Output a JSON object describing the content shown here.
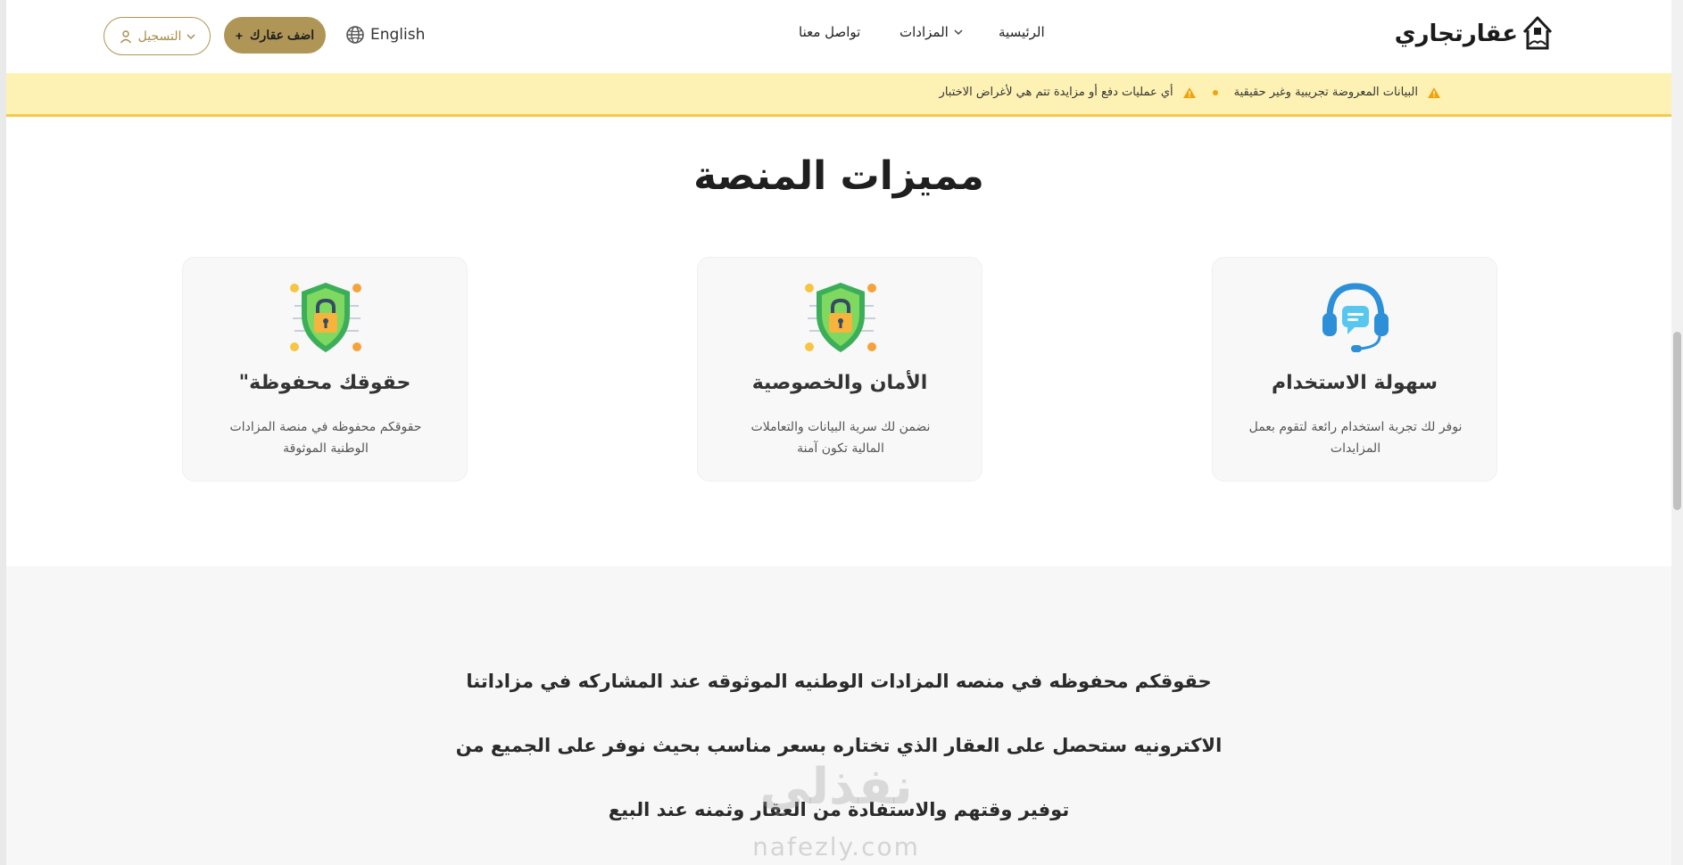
{
  "header": {
    "logo_text": "عقارتجاري",
    "nav": {
      "home": "الرئيسية",
      "auctions": "المزادات",
      "contact": "تواصل معنا"
    },
    "language": "English",
    "add_property": "اضف عقارك",
    "register": "التسجيل"
  },
  "banner": {
    "notice_1": "البيانات المعروضة تجريبية وغير حقيقية",
    "notice_2": "أي عمليات دفع أو مزايدة تتم هي لأغراض الاختبار"
  },
  "features": {
    "title": "مميزات المنصة",
    "cards": [
      {
        "title": "سهولة الاستخدام",
        "desc": "نوفر لك تجربة استخدام رائعة لتقوم بعمل المزايدات",
        "icon": "headset-chat-icon"
      },
      {
        "title": "الأمان والخصوصية",
        "desc": "نضمن لك سرية البيانات والتعاملات المالية تكون آمنة",
        "icon": "shield-lock-icon"
      },
      {
        "title": "\"حقوقك محفوظة",
        "desc": "حقوقكم محفوظه في منصة المزادات الوطنية الموثوقة",
        "icon": "shield-lock-icon"
      }
    ]
  },
  "about": {
    "lines": [
      "حقوقكم محفوظه في منصه المزادات الوطنيه الموثوقه عند المشاركه في مزاداتنا",
      "الاكترونيه ستحصل على العقار الذي تختاره بسعر مناسب بحيث نوفر على الجميع من",
      "توفير وقتهم والاستفادة من العقار وثمنه عند البيع"
    ]
  },
  "watermark": {
    "arabic": "نفذلي",
    "latin": "nafezly.com"
  },
  "colors": {
    "accent": "#b09656",
    "banner_bg": "#fdf2b3",
    "warning": "#f2a20c"
  }
}
